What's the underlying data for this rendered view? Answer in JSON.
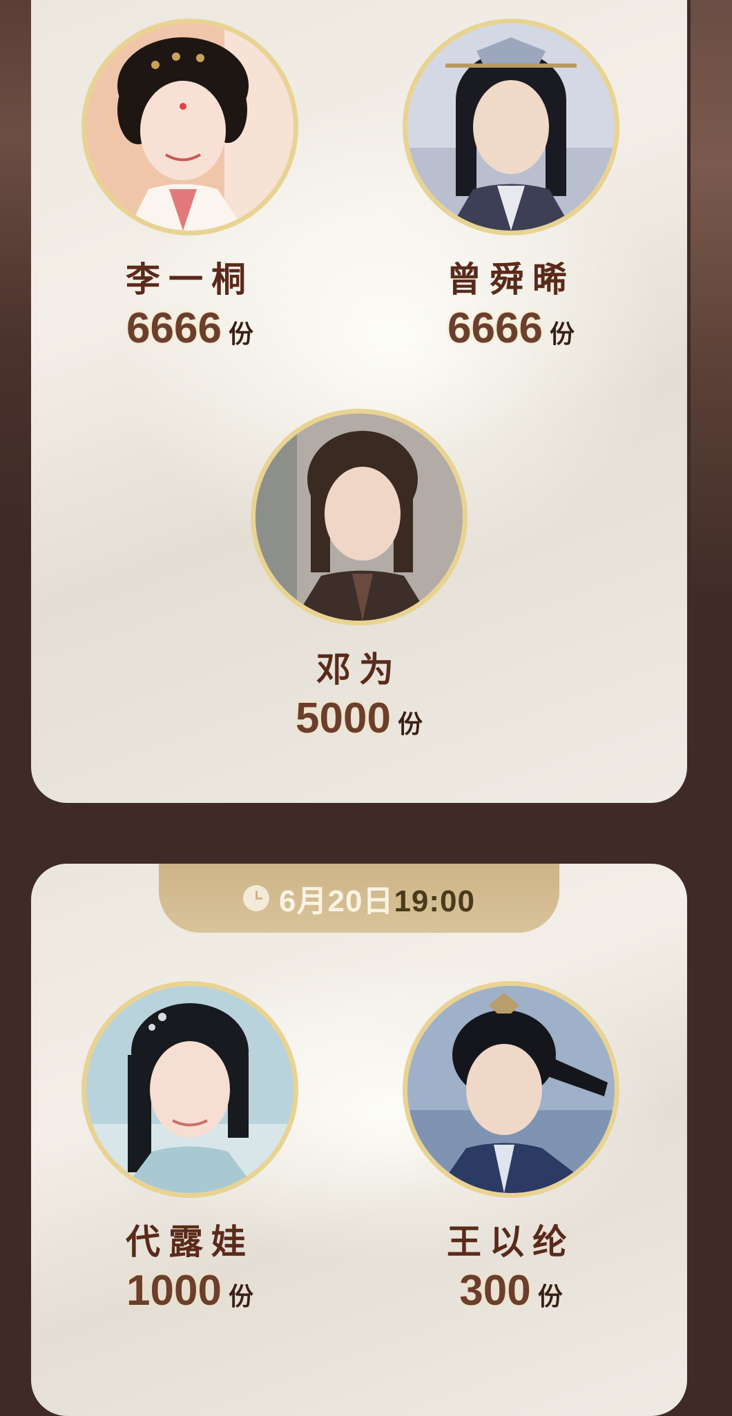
{
  "section1": {
    "people": [
      {
        "name": "李一桐",
        "count": "6666",
        "unit": "份",
        "avatar": "female-portrait-pink"
      },
      {
        "name": "曾舜晞",
        "count": "6666",
        "unit": "份",
        "avatar": "male-portrait-crown"
      },
      {
        "name": "邓为",
        "count": "5000",
        "unit": "份",
        "avatar": "male-portrait-dark"
      }
    ]
  },
  "section2": {
    "time_date": "6月20日",
    "time_hour": "19:00",
    "time_icon": "clock-icon",
    "people": [
      {
        "name": "代露娃",
        "count": "1000",
        "unit": "份",
        "avatar": "female-portrait-blue"
      },
      {
        "name": "王以纶",
        "count": "300",
        "unit": "份",
        "avatar": "male-portrait-blue"
      }
    ]
  },
  "colors": {
    "background": "#3e2a26",
    "card": "#efebe4",
    "ring": "#e9d393",
    "name": "#5a2a1a",
    "count": "#6b3e2e",
    "banner": "#cdb487"
  }
}
